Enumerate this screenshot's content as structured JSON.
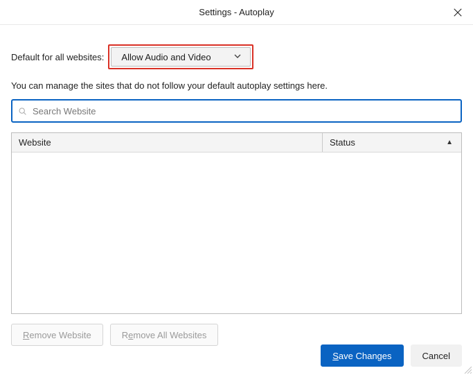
{
  "title": "Settings - Autoplay",
  "defaultRow": {
    "label": "Default for all websites:",
    "selected": "Allow Audio and Video"
  },
  "hint": "You can manage the sites that do not follow your default autoplay settings here.",
  "search": {
    "placeholder": "Search Website",
    "value": ""
  },
  "table": {
    "columns": {
      "website": "Website",
      "status": "Status"
    },
    "rows": []
  },
  "buttons": {
    "removeWebsite": "Remove Website",
    "removeAll": "Remove All Websites",
    "save": "Save Changes",
    "cancel": "Cancel"
  }
}
